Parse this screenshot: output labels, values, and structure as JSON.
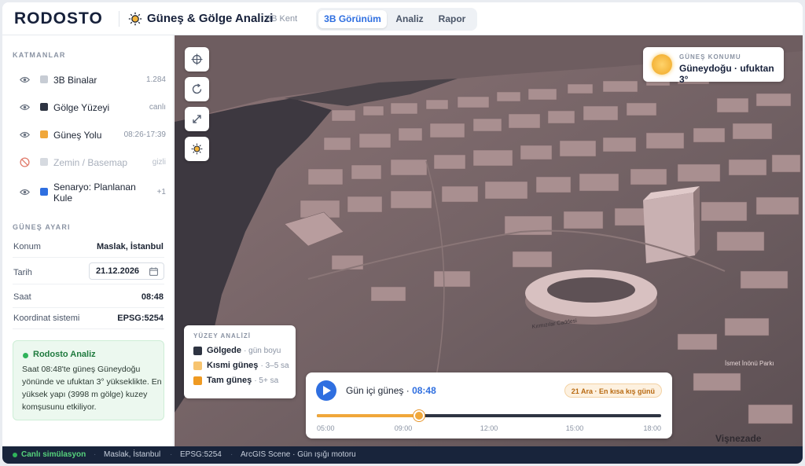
{
  "header": {
    "brand": "RODOSTO",
    "title": "Güneş & Gölge Analizi",
    "subtitle": "3B Kent",
    "tabs": [
      {
        "label": "3B Görünüm",
        "active": true
      },
      {
        "label": "Analiz",
        "active": false
      },
      {
        "label": "Rapor",
        "active": false
      }
    ]
  },
  "sidebar": {
    "layers_title": "KATMANLAR",
    "layers": [
      {
        "name": "3B Binalar",
        "value": "1.284",
        "color": "#c7ccd4",
        "visible": true
      },
      {
        "name": "Gölge Yüzeyi",
        "value": "canlı",
        "color": "#2e3442",
        "visible": true
      },
      {
        "name": "Güneş Yolu",
        "value": "08:26-17:39",
        "color": "#f0a73a",
        "visible": true
      },
      {
        "name": "Zemin / Basemap",
        "value": "gizli",
        "color": "#d6dae0",
        "visible": false
      },
      {
        "name": "Senaryo: Planlanan Kule",
        "value": "+1",
        "color": "#2f6fe0",
        "visible": true
      }
    ],
    "sun_title": "GÜNEŞ AYARI",
    "settings": {
      "location_label": "Konum",
      "location": "Maslak, İstanbul",
      "date_label": "Tarih",
      "date": "21.12.2026",
      "time_label": "Saat",
      "time": "08:48",
      "crs_label": "Koordinat sistemi",
      "crs": "EPSG:5254"
    },
    "note": {
      "title": "Rodosto Analiz",
      "body": "Saat 08:48'te güneş Güneydoğu yönünde ve ufuktan 3° yükseklikte. En yüksek yapı (3998 m gölge) kuzey komşusunu etkiliyor."
    }
  },
  "map": {
    "sun_position": {
      "label": "GÜNEŞ KONUMU",
      "value": "Güneydoğu · ufuktan 3°"
    },
    "controls": [
      "crosshair-icon",
      "rotate-icon",
      "expand-icon",
      "sun-icon"
    ],
    "legend": {
      "title": "YÜZEY ANALİZİ",
      "items": [
        {
          "name": "Gölgede",
          "meta": "· gün boyu",
          "color": "#2e3442"
        },
        {
          "name": "Kısmi güneş",
          "meta": "· 3–5 sa",
          "color": "#f7c46f"
        },
        {
          "name": "Tam güneş",
          "meta": "· 5+ sa",
          "color": "#ef9a22"
        }
      ]
    },
    "street_labels": [
      "Kırmızılar Caddesi",
      "İsmet İnönü Parkı",
      "Vişnezade"
    ],
    "timeline": {
      "title": "Gün içi güneş ·",
      "time": "08:48",
      "badge": "21 Ara · En kısa kış günü",
      "progress": 0.296,
      "ticks": [
        "05:00",
        "09:00",
        "12:00",
        "15:00",
        "18:00"
      ]
    }
  },
  "statusbar": {
    "live": "Canlı simülasyon",
    "location": "Maslak, İstanbul",
    "crs": "EPSG:5254",
    "engine": "ArcGIS Scene · Gün ışığı motoru"
  }
}
